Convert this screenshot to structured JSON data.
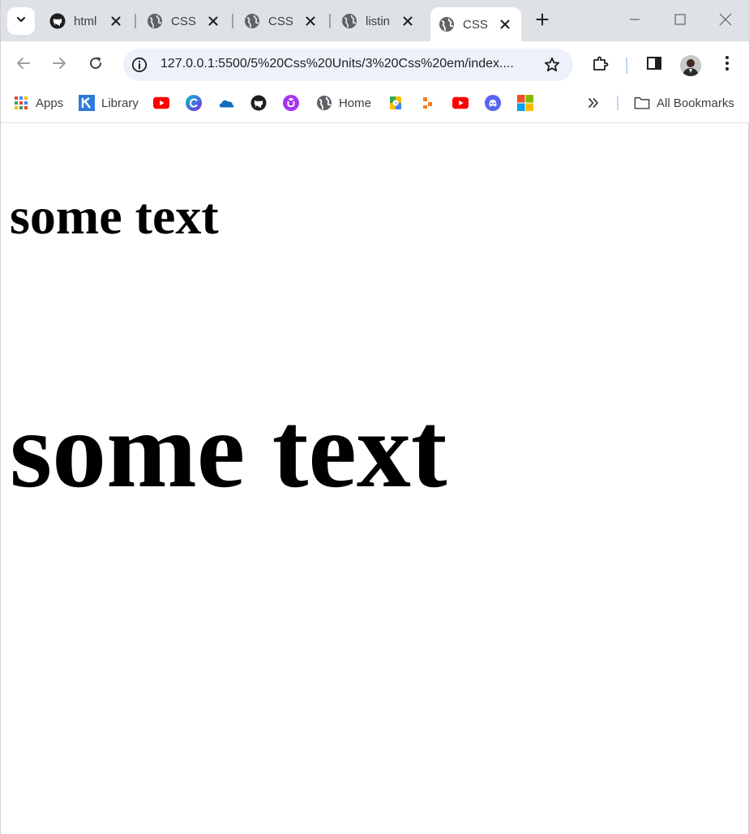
{
  "colors": {
    "tabstrip_bg": "#dee1e6",
    "omnibox_bg": "#edf2fa",
    "youtube_red": "#ff0000",
    "discord": "#5865f2",
    "icon_gray": "#5f6368"
  },
  "tabs": [
    {
      "title": "html",
      "icon": "github-icon"
    },
    {
      "title": "CSS",
      "icon": "globe-icon"
    },
    {
      "title": "CSS",
      "icon": "globe-icon"
    },
    {
      "title": "listin",
      "icon": "globe-icon"
    },
    {
      "title": "CSS",
      "icon": "globe-icon",
      "active": true
    }
  ],
  "toolbar": {
    "url": "127.0.0.1:5500/5%20Css%20Units/3%20Css%20em/index...."
  },
  "bookmarks": {
    "apps_label": "Apps",
    "library_label": "Library",
    "home_label": "Home",
    "all_bookmarks_label": "All Bookmarks"
  },
  "page": {
    "text_1": "some text",
    "text_2": "some text"
  }
}
